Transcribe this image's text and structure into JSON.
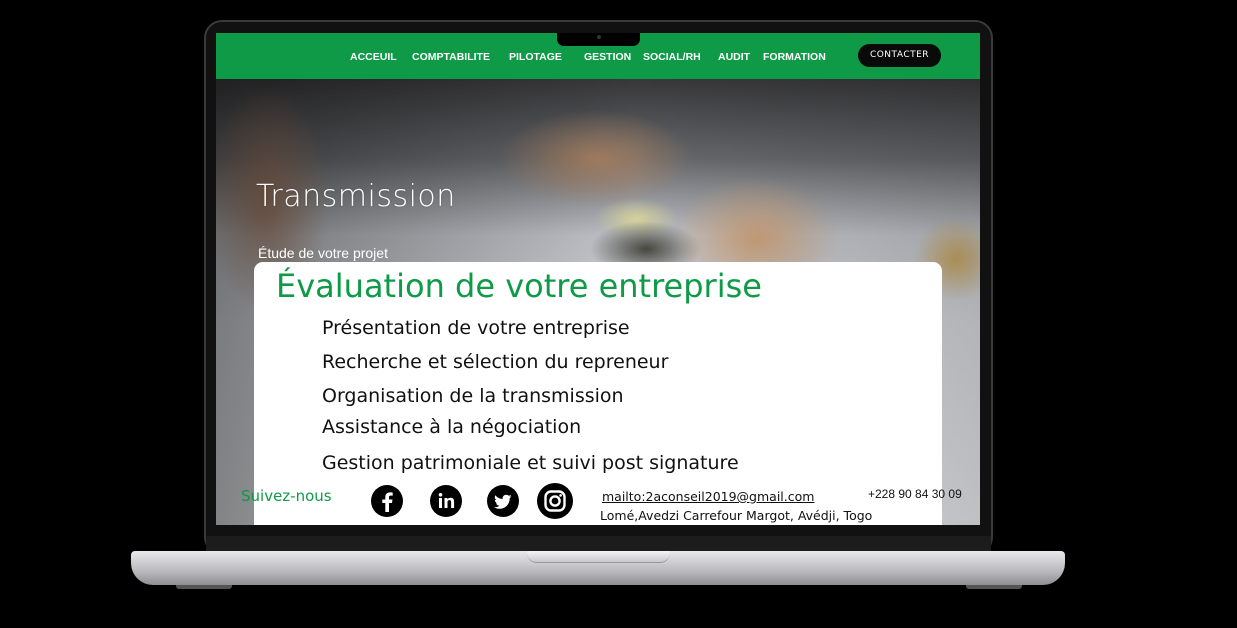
{
  "nav": {
    "items": [
      {
        "label": "ACCEUIL"
      },
      {
        "label": "COMPTABILITE"
      },
      {
        "label": "PILOTAGE"
      },
      {
        "label": "GESTION"
      },
      {
        "label": "SOCIAL/RH"
      },
      {
        "label": "AUDIT"
      },
      {
        "label": "FORMATION"
      }
    ],
    "contact_label": "CONTACTER"
  },
  "hero": {
    "title": "Transmission",
    "subtitle": "Étude de votre projet"
  },
  "card": {
    "title": "Évaluation de votre entreprise",
    "services": [
      "Présentation de votre entreprise",
      "Recherche et sélection du repreneur",
      "Organisation de la transmission",
      "Assistance à la négociation",
      "Gestion patrimoniale et suivi post signature"
    ]
  },
  "footer": {
    "follow_label": "Suivez-nous",
    "social_icons": [
      "facebook-icon",
      "linkedin-icon",
      "twitter-icon",
      "instagram-icon"
    ],
    "email": "mailto:2aconseil2019@gmail.com",
    "phone": "+228 90 84 30 09",
    "address": "Lomé,Avedzi Carrefour Margot, Avédji, Togo"
  },
  "colors": {
    "brand_green": "#0f9a47",
    "button_black": "#0a0a0a"
  }
}
